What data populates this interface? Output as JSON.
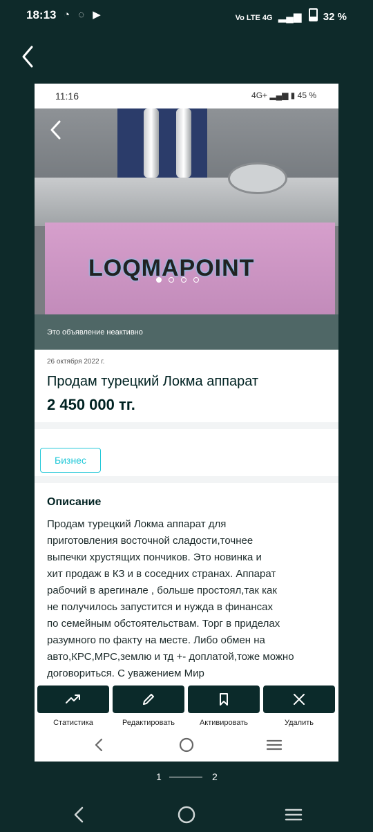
{
  "device_status": {
    "time": "18:13",
    "apps": "◔ ◌ ▶",
    "network": "Vo LTE 4G",
    "battery": "32 %"
  },
  "inner_status": {
    "time": "11:16",
    "network": "4G+",
    "battery": "45 %"
  },
  "photo": {
    "brand_text": "LOQMAPOINT",
    "slide_count": 4,
    "active_slide": 1
  },
  "listing": {
    "inactive_notice": "Это объявление неактивно",
    "date": "26 октября 2022 г.",
    "title": "Продам турецкий Локма аппарат",
    "price": "2 450 000 тг.",
    "category_tag": "Бизнес",
    "description_title": "Описание",
    "description_lines": [
      "Продам турецкий Локма аппарат для",
      "приготовления восточной сладости,точнее",
      "выпечки хрустящих пончиков. Это новинка и",
      "хит продаж в КЗ и в соседних странах. Аппарат",
      "рабочий в арегинале , больше простоял,так как",
      "не получилось запустится и нужда в финансах",
      "по семейным обстоятельствам. Торг в приделах",
      "разумного по факту на месте. Либо обмен на",
      "авто,КРС,МРС,землю и тд +- доплатой,тоже можно",
      "договориться. С уважением Мир"
    ]
  },
  "actions": [
    {
      "label": "Статистика",
      "icon": "trending-up-icon"
    },
    {
      "label": "Редактировать",
      "icon": "pencil-icon"
    },
    {
      "label": "Активировать",
      "icon": "bookmark-icon"
    },
    {
      "label": "Удалить",
      "icon": "close-icon"
    }
  ],
  "pager": {
    "current": "1",
    "total": "2"
  },
  "colors": {
    "page_bg": "#0e2a2a",
    "dark_button": "#0b2a2a",
    "banner": "#4f6766",
    "tag_accent": "#23c8d8"
  }
}
